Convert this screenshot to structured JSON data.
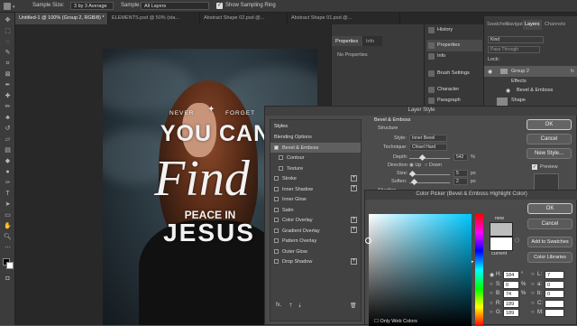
{
  "options_bar": {
    "sample_size_label": "Sample Size:",
    "sample_size_value": "3 by 3 Average",
    "sample_label": "Sample:",
    "sample_value": "All Layers",
    "show_ring_label": "Show Sampling Ring"
  },
  "doc_tabs": [
    {
      "label": "Untitled-1 @ 100% (Group 2, RGB/8) *",
      "active": true
    },
    {
      "label": "ELEMENTS.psd @ 50% (sta...",
      "active": false
    },
    {
      "label": "Abstract Shape 02.psd @...",
      "active": false
    },
    {
      "label": "Abstract Shape 01.psd @...",
      "active": false
    }
  ],
  "artwork": {
    "top_left": "NEVER",
    "top_right": "FORGET",
    "line1": "YOU CAN",
    "script": "Find",
    "line3": "PEACE IN",
    "line4": "JESUS"
  },
  "properties_panel": {
    "tab_properties": "Properties",
    "tab_info": "Info",
    "empty_text": "No Properties"
  },
  "icon_panel": [
    "History",
    "Properties",
    "Info",
    "Brush Settings",
    "Character",
    "Paragraph"
  ],
  "layers_panel": {
    "tabs": [
      "Swatches",
      "Navigator",
      "Layers",
      "Channels"
    ],
    "search_placeholder": "Kind",
    "blend_mode": "Pass Through",
    "lock_label": "Lock:",
    "layers": [
      "Group 2",
      "Effects",
      "Bevel & Emboss",
      "Shape"
    ]
  },
  "layer_style": {
    "title": "Layer Style",
    "styles_header": "Styles",
    "list": [
      {
        "label": "Blending Options",
        "checkbox": false,
        "plus": false,
        "sub": false
      },
      {
        "label": "Bevel & Emboss",
        "checkbox": true,
        "plus": false,
        "sub": false,
        "highlighted": true
      },
      {
        "label": "Contour",
        "checkbox": true,
        "plus": false,
        "sub": true
      },
      {
        "label": "Texture",
        "checkbox": true,
        "plus": false,
        "sub": true
      },
      {
        "label": "Stroke",
        "checkbox": true,
        "plus": true,
        "sub": false
      },
      {
        "label": "Inner Shadow",
        "checkbox": true,
        "plus": true,
        "sub": false
      },
      {
        "label": "Inner Glow",
        "checkbox": true,
        "plus": false,
        "sub": false
      },
      {
        "label": "Satin",
        "checkbox": true,
        "plus": false,
        "sub": false
      },
      {
        "label": "Color Overlay",
        "checkbox": true,
        "plus": true,
        "sub": false
      },
      {
        "label": "Gradient Overlay",
        "checkbox": true,
        "plus": true,
        "sub": false
      },
      {
        "label": "Pattern Overlay",
        "checkbox": true,
        "plus": false,
        "sub": false
      },
      {
        "label": "Outer Glow",
        "checkbox": true,
        "plus": false,
        "sub": false
      },
      {
        "label": "Drop Shadow",
        "checkbox": true,
        "plus": true,
        "sub": false
      }
    ],
    "fx_label": "fx.",
    "section_title": "Bevel & Emboss",
    "structure_label": "Structure",
    "style_label": "Style:",
    "style_value": "Inner Bevel",
    "technique_label": "Technique:",
    "technique_value": "Chisel Hard",
    "depth_label": "Depth:",
    "depth_value": "542",
    "percent": "%",
    "direction_label": "Direction:",
    "direction_up": "Up",
    "direction_down": "Down",
    "size_label": "Size:",
    "size_value": "5",
    "size_unit": "px",
    "soften_label": "Soften:",
    "soften_value": "2",
    "soften_unit": "px",
    "shading_label": "Shading",
    "buttons": {
      "ok": "OK",
      "cancel": "Cancel",
      "new_style": "New Style...",
      "preview": "Preview"
    }
  },
  "color_picker": {
    "title": "Color Picker (Bevel & Emboss Highlight Color)",
    "new_label": "new",
    "current_label": "current",
    "buttons": {
      "ok": "OK",
      "cancel": "Cancel",
      "add_to_swatches": "Add to Swatches",
      "color_libraries": "Color Libraries"
    },
    "only_web_colors": "Only Web Colors",
    "values": [
      {
        "label": "H:",
        "value": "184",
        "unit": "°",
        "radio_label": "L:",
        "radio_value": "7"
      },
      {
        "label": "S:",
        "value": "0",
        "unit": "%",
        "radio_label": "a:",
        "radio_value": "0"
      },
      {
        "label": "B:",
        "value": "74",
        "unit": "%",
        "radio_label": "b:",
        "radio_value": "0"
      },
      {
        "label": "R:",
        "value": "189",
        "unit": "",
        "radio_label": "C:",
        "radio_value": ""
      },
      {
        "label": "G:",
        "value": "189",
        "unit": "",
        "radio_label": "M:",
        "radio_value": ""
      }
    ],
    "new_color": "#bdbdbd",
    "current_color": "#ffffff"
  },
  "colors": {
    "dialog_bg": "#4b4b4b",
    "accent_highlight": "#5f5f5f"
  }
}
